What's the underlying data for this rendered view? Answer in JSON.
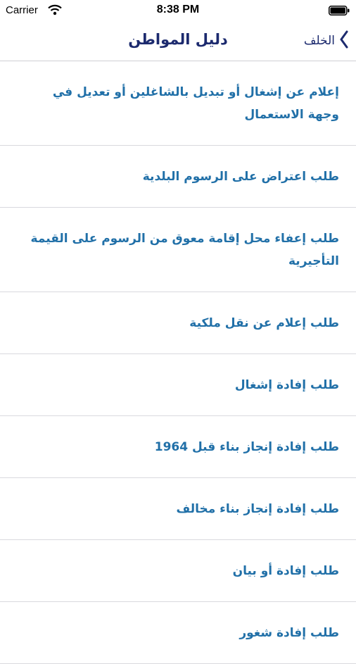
{
  "status_bar": {
    "carrier": "Carrier",
    "time": "8:38 PM"
  },
  "nav": {
    "title": "دليل المواطن",
    "back_label": "الخلف"
  },
  "list": {
    "items": [
      {
        "label": "إعلام عن إشغال أو تبديل بالشاغلين أو تعديل في وجهة الاستعمال"
      },
      {
        "label": "طلب اعتراض على الرسوم البلدية"
      },
      {
        "label": "طلب إعفاء محل إقامة معوق من الرسوم على القيمة التأجيرية"
      },
      {
        "label": "طلب إعلام عن نقل ملكية"
      },
      {
        "label": "طلب إفادة إشغال"
      },
      {
        "label": "طلب إفادة إنجاز بناء قبل 1964"
      },
      {
        "label": "طلب إفادة إنجاز بناء مخالف"
      },
      {
        "label": "طلب إفادة أو بيان"
      },
      {
        "label": "طلب إفادة شغور"
      }
    ]
  },
  "colors": {
    "nav_title": "#1c2a6e",
    "item_text": "#2170a8",
    "separator": "#d9d9de"
  },
  "icons": {
    "back": "chevron-left-icon",
    "wifi": "wifi-icon",
    "battery": "battery-icon"
  }
}
